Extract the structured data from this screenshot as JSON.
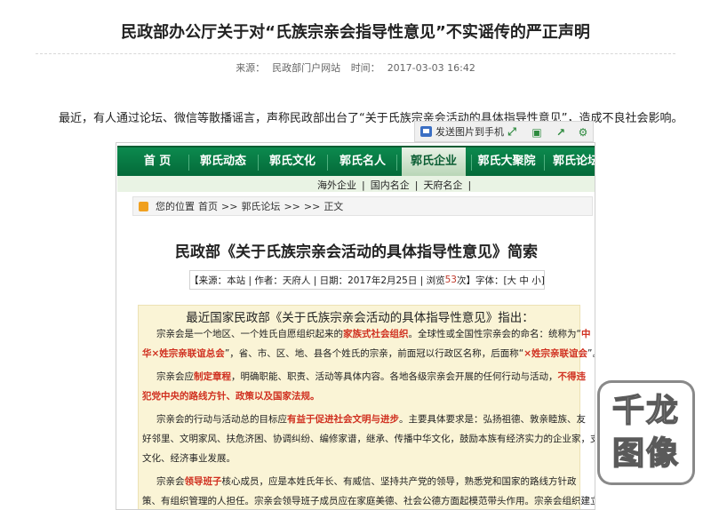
{
  "title": "民政部办公厅关于对“氏族宗亲会指导性意见”不实谣传的严正声明",
  "meta": {
    "source_label": "来源：",
    "source": "民政部门户网站",
    "time_label": "时间：",
    "time": "2017-03-03 16:42"
  },
  "intro": "最近，有人通过论坛、微信等散播谣言，声称民政部出台了“关于氏族宗亲会活动的具体指导性意见”，造成不良社会影响。",
  "toolbar": {
    "send_label": "发送图片到手机",
    "icons": [
      "expand-icon",
      "save-icon",
      "share-icon",
      "settings-icon"
    ]
  },
  "embedded": {
    "nav": [
      "首 页",
      "郭氏动态",
      "郭氏文化",
      "郭氏名人",
      "郭氏企业",
      "郭氏大聚院",
      "郭氏论坛"
    ],
    "subnav": [
      "海外企业",
      "|",
      "国内名企",
      "|",
      "天府名企",
      "|"
    ],
    "breadcrumb": [
      "您的位置",
      "首页",
      ">>",
      "郭氏论坛",
      ">>",
      ">>",
      "正文"
    ],
    "article_title": "民政部《关于氏族宗亲会活动的具体指导性意见》简索",
    "article_meta": {
      "prefix": "【来源：本站 | 作者：天府人 | 日期：2017年2月25日 | 浏览",
      "views": "53",
      "suffix": "次】字体：[大  中  小]"
    },
    "lead": "最近国家民政部《关于氏族宗亲会活动的具体指导性意见》指出：",
    "p1a": "宗亲会是一个地区、一个姓氏自愿组织起来的",
    "p1b": "家族式社会组织",
    "p1c": "。全球性或全国性宗亲会的命名：统称为“",
    "p1d": "中",
    "p2a": "华×姓宗亲联谊总会",
    "p2b": "”，省、市、区、地、县各个姓氏的宗亲，前面冠以行政区名称，后面称“",
    "p2c": "×姓宗亲联谊会",
    "p2d": "”。",
    "p3a": "宗亲会应",
    "p3b": "制定章程",
    "p3c": "，明确职能、职责、活动等具体内容。各地各级宗亲会开展的任何行动与活动，",
    "p3d": "不得违",
    "p4": "犯党中央的路线方针、政策以及国家法规。",
    "p5a": "宗亲会的行动与活动总的目标应",
    "p5b": "有益于促进社会文明与进步",
    "p5c": "。主要具体要求是：弘扬祖德、敦亲睦族、友",
    "p6": "好邻里、文明家风、扶危济困、协调纠纷、编修家谱，继承、传播中华文化，鼓励本族有经济实力的企业家，支持",
    "p7": "文化、经济事业发展。",
    "p8a": "宗亲会",
    "p8b": "领导班子",
    "p8c": "核心成员，应是本姓氏年长、有威信、坚持共产党的领导，熟悉党和国家的路线方针政",
    "p9": "策、有组织管理的人担任。宗亲会领导班子成员应在家庭美德、社会公德方面起模范带头作用。宗亲会组织建立及"
  },
  "watermark": "千龙图像"
}
